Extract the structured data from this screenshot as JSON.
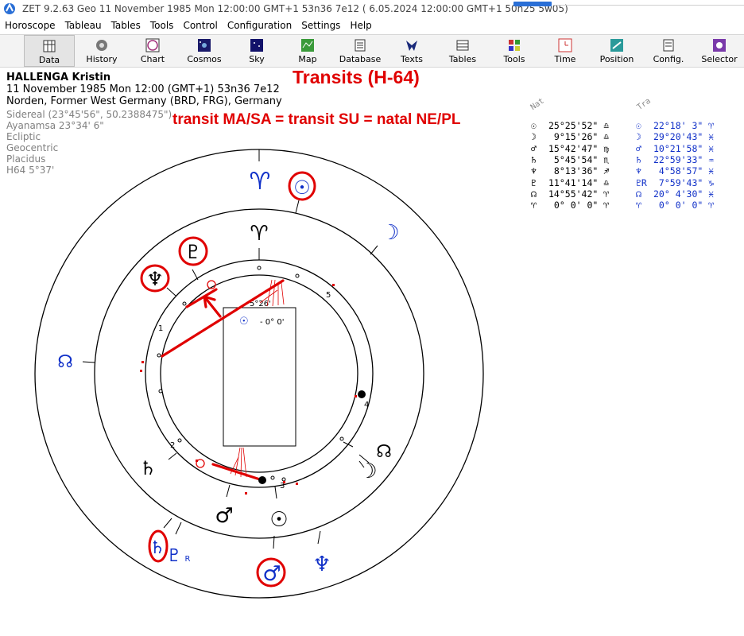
{
  "window": {
    "title": "ZET 9.2.63 Geo   11 November 1985  Mon  12:00:00 GMT+1 53n36  7e12  ( 6.05.2024  12:00:00 GMT+1 50n25 5w05)"
  },
  "menu": [
    "Horoscope",
    "Tableau",
    "Tables",
    "Tools",
    "Control",
    "Configuration",
    "Settings",
    "Help"
  ],
  "toolbar": [
    {
      "label": "Data",
      "icon": "data-icon"
    },
    {
      "label": "History",
      "icon": "history-icon"
    },
    {
      "label": "Chart",
      "icon": "chart-icon"
    },
    {
      "label": "Cosmos",
      "icon": "cosmos-icon"
    },
    {
      "label": "Sky",
      "icon": "sky-icon"
    },
    {
      "label": "Map",
      "icon": "map-icon"
    },
    {
      "label": "Database",
      "icon": "database-icon"
    },
    {
      "label": "Texts",
      "icon": "texts-icon"
    },
    {
      "label": "Tables",
      "icon": "tables-icon"
    },
    {
      "label": "Tools",
      "icon": "tools-icon"
    },
    {
      "label": "Time",
      "icon": "time-icon"
    },
    {
      "label": "Position",
      "icon": "position-icon"
    },
    {
      "label": "Config.",
      "icon": "config-icon"
    },
    {
      "label": "Selector",
      "icon": "selector-icon"
    }
  ],
  "person": {
    "name": "HALLENGA Kristin",
    "datetime": "11 November 1985  Mon  12:00 (GMT+1) 53n36  7e12",
    "place": "Norden, Former West Germany (BRD, FRG), Germany",
    "settings": [
      "Sidereal (23°45'56\", 50.2388475\")",
      "Ayanamsa 23°34' 6\"",
      "Ecliptic",
      "Geocentric",
      "Placidus",
      "H64   5°37'"
    ]
  },
  "annotation": {
    "title": "Transits (H-64)",
    "subtitle": "transit MA/SA = transit SU = natal NE/PL"
  },
  "table": {
    "nat_header": "Nat",
    "tra_header": "Tra",
    "rows": [
      {
        "glyph": "☉",
        "nat": "25°25'52\" ♎",
        "tra_glyph": "☉",
        "tra": "22°18' 3\" ♈"
      },
      {
        "glyph": "☽",
        "nat": " 9°15'26\" ♎",
        "tra_glyph": "☽",
        "tra": "29°20'43\" ♓"
      },
      {
        "glyph": "♂",
        "nat": "15°42'47\" ♍",
        "tra_glyph": "♂",
        "tra": "10°21'58\" ♓"
      },
      {
        "glyph": "♄",
        "nat": " 5°45'54\" ♏",
        "tra_glyph": "♄",
        "tra": "22°59'33\" ♒"
      },
      {
        "glyph": "♆",
        "nat": " 8°13'36\" ♐",
        "tra_glyph": "♆",
        "tra": " 4°58'57\" ♓"
      },
      {
        "glyph": "♇",
        "nat": "11°41'14\" ♎",
        "tra_glyph": "♇R",
        "tra": " 7°59'43\" ♑"
      },
      {
        "glyph": "☊",
        "nat": "14°55'42\" ♈",
        "tra_glyph": "☊",
        "tra": "20° 4'30\" ♓"
      },
      {
        "glyph": "♈",
        "nat": " 0° 0' 0\" ♈",
        "tra_glyph": "♈",
        "tra": " 0° 0' 0\" ♈"
      }
    ]
  },
  "wheel": {
    "box_glyph": "☉",
    "box_value": "- 0° 0'",
    "axis_label": "5°26'",
    "house_numbers": [
      "1",
      "2",
      "3",
      "4",
      "5"
    ],
    "outer_glyphs": [
      {
        "name": "transit-aries",
        "glyph": "♈",
        "color": "#1030c8"
      },
      {
        "name": "transit-sun",
        "glyph": "☉",
        "color": "#1030c8"
      },
      {
        "name": "transit-moon",
        "glyph": "☽",
        "color": "#1030c8"
      },
      {
        "name": "transit-node",
        "glyph": "☊",
        "color": "#1030c8"
      },
      {
        "name": "transit-neptune",
        "glyph": "♆",
        "color": "#1030c8"
      },
      {
        "name": "transit-mars",
        "glyph": "♂",
        "color": "#1030c8"
      },
      {
        "name": "transit-saturn",
        "glyph": "♄",
        "color": "#1030c8"
      },
      {
        "name": "transit-pluto",
        "glyph": "♇",
        "color": "#1030c8"
      },
      {
        "name": "transit-pluto-retro",
        "glyph": "R",
        "color": "#1030c8"
      }
    ],
    "inner_glyphs": [
      {
        "name": "natal-aries",
        "glyph": "♈",
        "color": "#000000"
      },
      {
        "name": "natal-pluto",
        "glyph": "♇",
        "color": "#000000"
      },
      {
        "name": "natal-neptune",
        "glyph": "♆",
        "color": "#000000"
      },
      {
        "name": "natal-saturn",
        "glyph": "♄",
        "color": "#000000"
      },
      {
        "name": "natal-mars",
        "glyph": "♂",
        "color": "#000000"
      },
      {
        "name": "natal-sun",
        "glyph": "☉",
        "color": "#000000"
      },
      {
        "name": "natal-moon",
        "glyph": "☽",
        "color": "#000000"
      },
      {
        "name": "natal-node",
        "glyph": "☊",
        "color": "#000000"
      }
    ],
    "colors": {
      "natal": "#000000",
      "transit": "#1030c8",
      "highlight": "#e00000"
    }
  }
}
